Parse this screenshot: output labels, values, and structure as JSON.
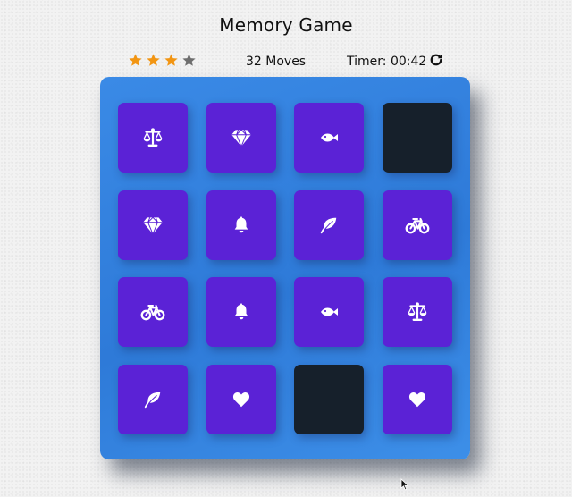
{
  "title": "Memory Game",
  "score": {
    "stars_filled": 3,
    "stars_total": 4,
    "star_color": "#f29512",
    "star_empty_color": "#6e6e6e",
    "moves": "32 Moves",
    "timer": "Timer: 00:42",
    "restart_icon": "redo-icon"
  },
  "deck": {
    "rows": 4,
    "cols": 4,
    "background": "#2e7ad8",
    "card_color": "#5b22d6",
    "hidden_card_color": "#16202b",
    "cards": [
      {
        "icon": "balance-scale",
        "state": "open"
      },
      {
        "icon": "diamond",
        "state": "open"
      },
      {
        "icon": "fish",
        "state": "open"
      },
      {
        "icon": "",
        "state": "hidden"
      },
      {
        "icon": "diamond",
        "state": "open"
      },
      {
        "icon": "bell",
        "state": "open"
      },
      {
        "icon": "leaf",
        "state": "open"
      },
      {
        "icon": "bicycle",
        "state": "open"
      },
      {
        "icon": "bicycle",
        "state": "open"
      },
      {
        "icon": "bell",
        "state": "open"
      },
      {
        "icon": "fish",
        "state": "open"
      },
      {
        "icon": "balance-scale",
        "state": "open"
      },
      {
        "icon": "leaf",
        "state": "open"
      },
      {
        "icon": "heart",
        "state": "open"
      },
      {
        "icon": "",
        "state": "hidden"
      },
      {
        "icon": "heart",
        "state": "open"
      }
    ]
  }
}
